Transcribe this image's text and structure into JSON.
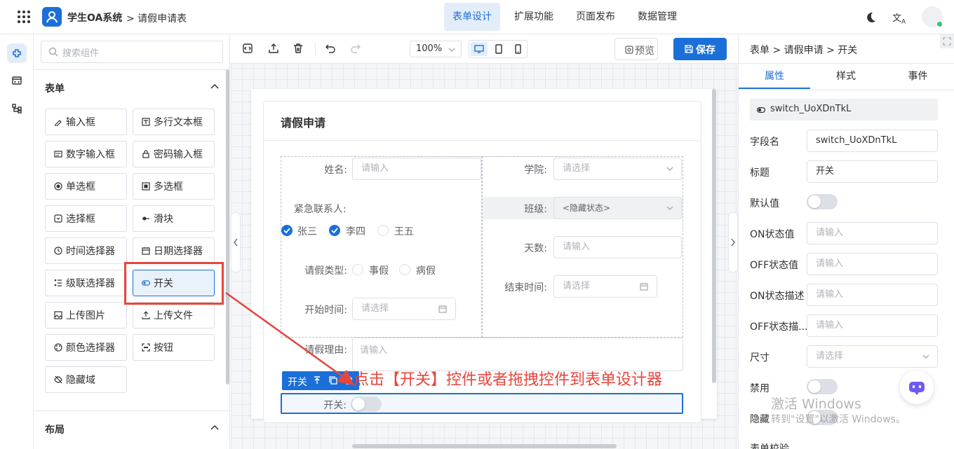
{
  "app": {
    "name": "学生OA系统",
    "breadcrumb": "> 请假申请表"
  },
  "topnav": [
    {
      "label": "表单设计",
      "active": true
    },
    {
      "label": "扩展功能",
      "active": false
    },
    {
      "label": "页面发布",
      "active": false
    },
    {
      "label": "数据管理",
      "active": false
    }
  ],
  "components": {
    "search_placeholder": "搜索组件",
    "form_section": "表单",
    "layout_section": "布局",
    "items": [
      {
        "label": "输入框",
        "icon": "pencil-icon"
      },
      {
        "label": "多行文本框",
        "icon": "textarea-icon"
      },
      {
        "label": "数字输入框",
        "icon": "number-icon"
      },
      {
        "label": "密码输入框",
        "icon": "lock-icon"
      },
      {
        "label": "单选框",
        "icon": "radio-icon"
      },
      {
        "label": "多选框",
        "icon": "checkbox-icon"
      },
      {
        "label": "选择框",
        "icon": "select-icon"
      },
      {
        "label": "滑块",
        "icon": "slider-icon"
      },
      {
        "label": "时间选择器",
        "icon": "clock-icon"
      },
      {
        "label": "日期选择器",
        "icon": "calendar-icon"
      },
      {
        "label": "级联选择器",
        "icon": "cascader-icon"
      },
      {
        "label": "开关",
        "icon": "switch-icon"
      },
      {
        "label": "上传图片",
        "icon": "image-icon"
      },
      {
        "label": "上传文件",
        "icon": "upload-icon"
      },
      {
        "label": "颜色选择器",
        "icon": "palette-icon"
      },
      {
        "label": "按钮",
        "icon": "button-icon"
      },
      {
        "label": "隐藏域",
        "icon": "eye-off-icon"
      }
    ]
  },
  "toolbar": {
    "zoom": "100%",
    "preview_label": "预览",
    "save_label": "保存"
  },
  "form": {
    "title": "请假申请",
    "name_label": "姓名:",
    "name_placeholder": "请输入",
    "college_label": "学院:",
    "college_placeholder": "请选择",
    "contact_label": "紧急联系人:",
    "contacts": [
      {
        "label": "张三",
        "checked": true
      },
      {
        "label": "李四",
        "checked": true
      },
      {
        "label": "王五",
        "checked": false
      }
    ],
    "class_label": "班级:",
    "class_value": "<隐藏状态>",
    "days_label": "天数:",
    "days_placeholder": "请输入",
    "type_label": "请假类型:",
    "types": [
      {
        "label": "事假"
      },
      {
        "label": "病假"
      }
    ],
    "end_label": "结束时间:",
    "end_placeholder": "请选择",
    "start_label": "开始时间:",
    "start_placeholder": "请选择",
    "reason_label": "请假理由:",
    "reason_placeholder": "请输入",
    "selected_tag": "开关",
    "switch_label": "开关:"
  },
  "annotation": "点击【开关】控件或者拖拽控件到表单设计器",
  "props": {
    "breadcrumb": "表单 > 请假申请 > 开关",
    "tabs": [
      {
        "label": "属性",
        "active": true
      },
      {
        "label": "样式",
        "active": false
      },
      {
        "label": "事件",
        "active": false
      }
    ],
    "component_id": "switch_UoXDnTkL",
    "field_name_label": "字段名",
    "field_name_value": "switch_UoXDnTkL",
    "title_label": "标题",
    "title_value": "开关",
    "default_label": "默认值",
    "on_value_label": "ON状态值",
    "on_value_placeholder": "请输入",
    "off_value_label": "OFF状态值",
    "off_value_placeholder": "请输入",
    "on_desc_label": "ON状态描述",
    "on_desc_placeholder": "请输入",
    "off_desc_label": "OFF状态描...",
    "off_desc_placeholder": "请输入",
    "size_label": "尺寸",
    "size_placeholder": "请选择",
    "disabled_label": "禁用",
    "hidden_label": "隐藏",
    "validate_label": "表单校验"
  },
  "watermark": {
    "line1": "激活 Windows",
    "line2": "转到\"设置\"以激活 Windows。"
  },
  "colors": {
    "primary": "#1b6fd8",
    "annotation_red": "#e8453c"
  }
}
